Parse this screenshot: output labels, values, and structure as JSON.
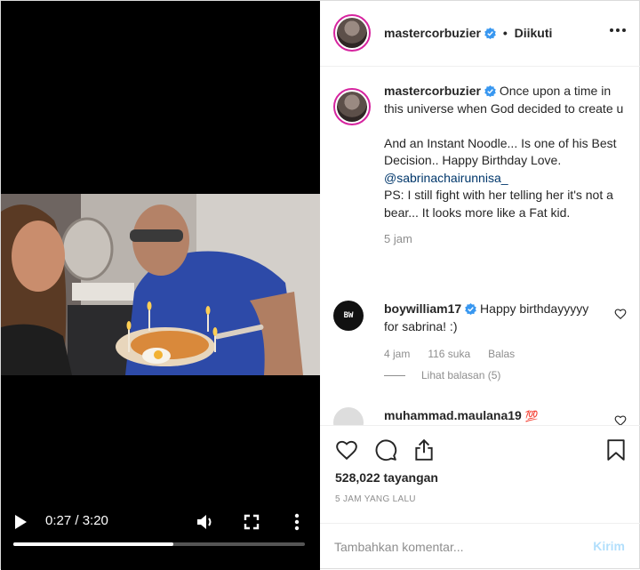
{
  "video": {
    "time_display": "0:27 / 3:20",
    "progress_fraction": 0.55,
    "buffered_fraction": 0.55
  },
  "header": {
    "username": "mastercorbuzier",
    "separator": "•",
    "follow_status": "Diikuti"
  },
  "caption": {
    "username": "mastercorbuzier",
    "line1": "Once upon a time in this universe when God decided to create u",
    "line2": "And an Instant Noodle... Is one of his Best Decision.. Happy Birthday Love.",
    "mention": "@sabrinachairunnisa_",
    "line3": "PS: I still fight with her telling her it's not a bear... It looks more like a Fat kid.",
    "time": "5 jam"
  },
  "comments": [
    {
      "username": "boywilliam17",
      "text": "Happy birthdayyyyy for sabrina! :)",
      "avatar_text": "BW",
      "time": "4 jam",
      "likes": "116 suka",
      "reply_label": "Balas",
      "view_replies": "Lihat balasan (5)"
    },
    {
      "username": "muhammad.maulana19",
      "emoji": "💯"
    }
  ],
  "actions": {
    "views": "528,022 tayangan",
    "posted": "5 JAM YANG LALU"
  },
  "comment_box": {
    "placeholder": "Tambahkan komentar...",
    "post_label": "Kirim"
  },
  "colors": {
    "verified": "#3897f0",
    "mention": "#00376b",
    "muted": "#8e8e8e",
    "post_disabled": "#b2dffc"
  }
}
